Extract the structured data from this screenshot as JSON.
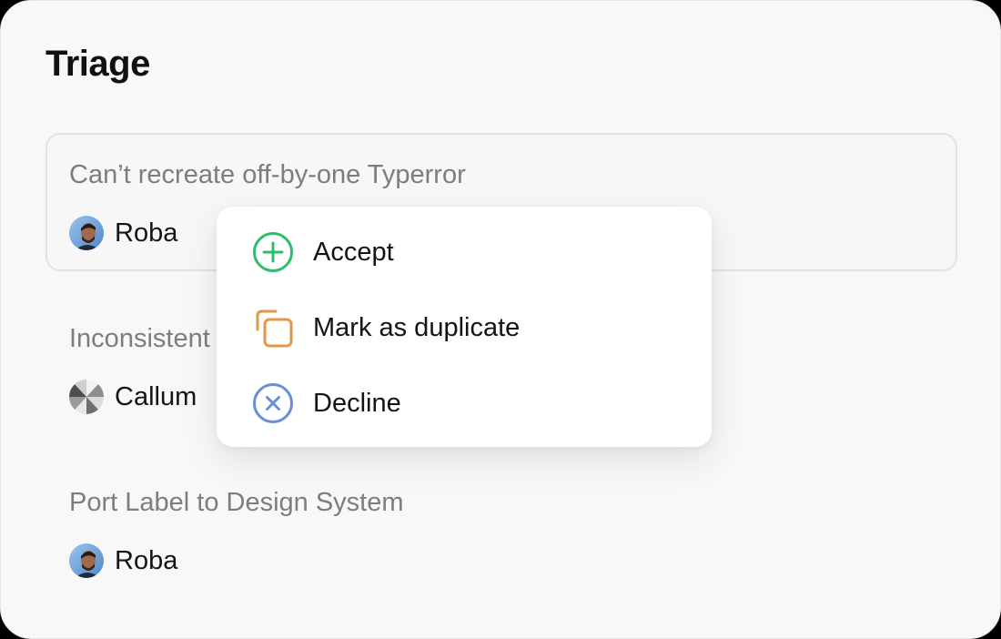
{
  "page": {
    "title": "Triage"
  },
  "issues": [
    {
      "title": "Can’t recreate off-by-one Typerror",
      "assignee": "Roba"
    },
    {
      "title": "Inconsistent",
      "assignee": "Callum"
    },
    {
      "title": "Port Label to Design System",
      "assignee": "Roba"
    }
  ],
  "menu": {
    "items": [
      {
        "label": "Accept",
        "icon": "plus-circle-icon",
        "color": "#2ebd6b"
      },
      {
        "label": "Mark as duplicate",
        "icon": "duplicate-icon",
        "color": "#e0994a"
      },
      {
        "label": "Decline",
        "icon": "x-circle-icon",
        "color": "#6a8fd6"
      }
    ]
  },
  "colors": {
    "panel_background": "#f8f8f8",
    "selected_border": "#e2e2e2",
    "muted_text": "#7d7d7d",
    "strong_text": "#141414"
  }
}
